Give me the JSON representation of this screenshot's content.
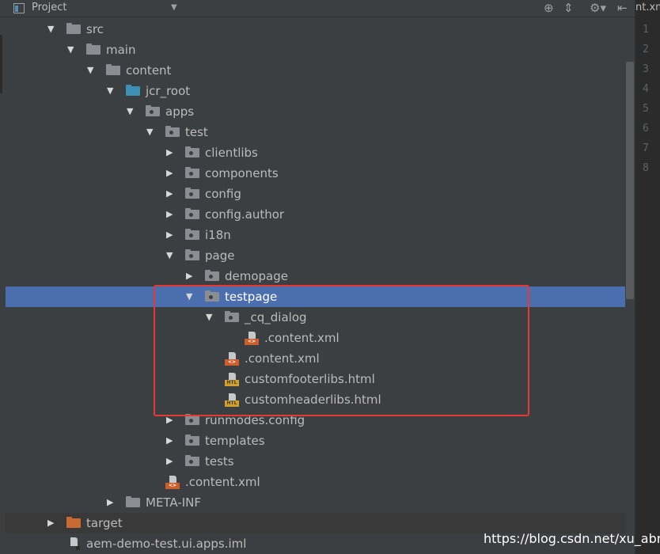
{
  "header": {
    "title": "Project",
    "tools": [
      "locate-icon",
      "collapse-icon",
      "gear-icon",
      "hide-icon"
    ]
  },
  "editor": {
    "tab_title": "nt.xm",
    "line_numbers": [
      "1",
      "2",
      "3",
      "4",
      "5",
      "6",
      "7",
      "8"
    ]
  },
  "tree": [
    {
      "label": "src",
      "level": 0,
      "arrow": "down",
      "icon": "folder-gray"
    },
    {
      "label": "main",
      "level": 1,
      "arrow": "down",
      "icon": "folder-gray"
    },
    {
      "label": "content",
      "level": 2,
      "arrow": "down",
      "icon": "folder-gray"
    },
    {
      "label": "jcr_root",
      "level": 3,
      "arrow": "down",
      "icon": "folder-blue"
    },
    {
      "label": "apps",
      "level": 4,
      "arrow": "down",
      "icon": "folder-package"
    },
    {
      "label": "test",
      "level": 5,
      "arrow": "down",
      "icon": "folder-package"
    },
    {
      "label": "clientlibs",
      "level": 6,
      "arrow": "right",
      "icon": "folder-package"
    },
    {
      "label": "components",
      "level": 6,
      "arrow": "right",
      "icon": "folder-package"
    },
    {
      "label": "config",
      "level": 6,
      "arrow": "right",
      "icon": "folder-package"
    },
    {
      "label": "config.author",
      "level": 6,
      "arrow": "right",
      "icon": "folder-package"
    },
    {
      "label": "i18n",
      "level": 6,
      "arrow": "right",
      "icon": "folder-package"
    },
    {
      "label": "page",
      "level": 6,
      "arrow": "down",
      "icon": "folder-package"
    },
    {
      "label": "demopage",
      "level": 7,
      "arrow": "right",
      "icon": "folder-package"
    },
    {
      "label": "testpage",
      "level": 7,
      "arrow": "down",
      "icon": "folder-package",
      "selected": true
    },
    {
      "label": "_cq_dialog",
      "level": 8,
      "arrow": "down",
      "icon": "folder-package"
    },
    {
      "label": ".content.xml",
      "level": 9,
      "arrow": "none",
      "icon": "xml"
    },
    {
      "label": ".content.xml",
      "level": 8,
      "arrow": "none",
      "icon": "xml"
    },
    {
      "label": "customfooterlibs.html",
      "level": 8,
      "arrow": "none",
      "icon": "htl"
    },
    {
      "label": "customheaderlibs.html",
      "level": 8,
      "arrow": "none",
      "icon": "htl"
    },
    {
      "label": "runmodes.config",
      "level": 6,
      "arrow": "right",
      "icon": "folder-package"
    },
    {
      "label": "templates",
      "level": 6,
      "arrow": "right",
      "icon": "folder-package"
    },
    {
      "label": "tests",
      "level": 6,
      "arrow": "right",
      "icon": "folder-package"
    },
    {
      "label": ".content.xml",
      "level": 5,
      "arrow": "none",
      "icon": "xml"
    },
    {
      "label": "META-INF",
      "level": 3,
      "arrow": "right",
      "icon": "folder-gray"
    },
    {
      "label": "target",
      "level": 0,
      "arrow": "right",
      "icon": "folder-orange",
      "bottom": true
    },
    {
      "label": "aem-demo-test.ui.apps.iml",
      "level": 0,
      "arrow": "none",
      "icon": "iml"
    }
  ],
  "colors": {
    "selection": "#4b6eaf",
    "highlight_box": "#e53935",
    "folder_gray": "#8a8e92",
    "folder_blue": "#3d8fb4",
    "folder_orange": "#c86a33"
  },
  "watermark": "https://blog.csdn.net/xu_abner"
}
